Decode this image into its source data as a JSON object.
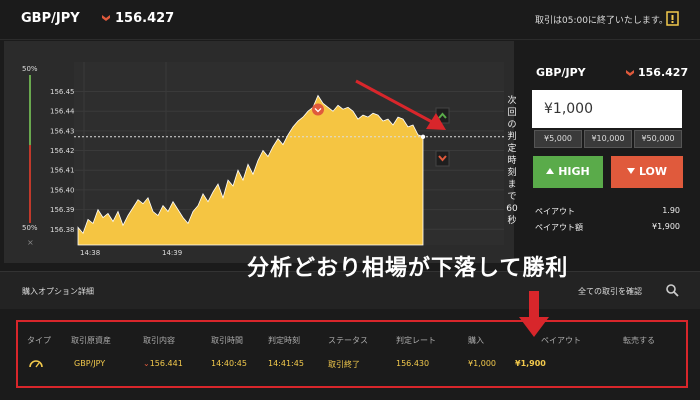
{
  "header": {
    "pair": "GBP/JPY",
    "price": "156.427",
    "notice": "取引は05:00に終了いたします。",
    "down_icon": "red-down-chevron",
    "notice_icon": "notice-icon"
  },
  "chart": {
    "vol_top": "50%",
    "vol_bottom": "50%",
    "vol_close": "×",
    "countdown": "次回の判定時刻まで60秒",
    "up_marker": "green-up-chevron",
    "down_marker": "red-down-chevron",
    "colors": {
      "area": "#f5c542",
      "high": "#5aab4a",
      "low": "#e05a3c",
      "annotation_red": "#d8262b"
    }
  },
  "chart_data": {
    "type": "area",
    "x": [
      0,
      5,
      10,
      15,
      20,
      25,
      30,
      35,
      40,
      45,
      50,
      55,
      60,
      65,
      70,
      75,
      80,
      85,
      90,
      95,
      100,
      105,
      110,
      115,
      120,
      125,
      130,
      135,
      140,
      145,
      150,
      155,
      160,
      165,
      170,
      175,
      180,
      185,
      190,
      195,
      200,
      205,
      210,
      215,
      220,
      225,
      230,
      235,
      240,
      245,
      250,
      255,
      260,
      265,
      270,
      275,
      280,
      285,
      290,
      295,
      300,
      305,
      310,
      315,
      320,
      325,
      330,
      335,
      340,
      345
    ],
    "values": [
      156.381,
      156.378,
      156.385,
      156.383,
      156.39,
      156.386,
      156.388,
      156.384,
      156.389,
      156.382,
      156.387,
      156.391,
      156.395,
      156.393,
      156.396,
      156.389,
      156.387,
      156.392,
      156.389,
      156.394,
      156.39,
      156.386,
      156.383,
      156.389,
      156.392,
      156.398,
      156.394,
      156.399,
      156.403,
      156.396,
      156.405,
      156.402,
      156.41,
      156.405,
      156.413,
      156.408,
      156.415,
      156.42,
      156.417,
      156.422,
      156.426,
      156.423,
      156.428,
      156.432,
      156.435,
      156.437,
      156.44,
      156.442,
      156.448,
      156.444,
      156.442,
      156.44,
      156.443,
      156.441,
      156.442,
      156.44,
      156.436,
      156.438,
      156.437,
      156.439,
      156.438,
      156.435,
      156.436,
      156.433,
      156.437,
      156.436,
      156.432,
      156.433,
      156.428,
      156.427
    ],
    "ylim": [
      156.372,
      156.465
    ],
    "y_ticks": [
      "156.45",
      "156.44",
      "156.43",
      "156.42",
      "156.41",
      "156.40",
      "156.39",
      "156.38"
    ],
    "x_ticks": [
      "14:38",
      "14:39"
    ],
    "reference_line": 156.427
  },
  "order": {
    "pair": "GBP/JPY",
    "price": "156.427",
    "amount": "¥1,000",
    "presets": [
      "¥5,000",
      "¥10,000",
      "¥50,000"
    ],
    "high_label": "HIGH",
    "low_label": "LOW",
    "payout_label": "ペイアウト",
    "payout_value": "1.90",
    "payout_amount_label": "ペイアウト額",
    "payout_amount_value": "¥1,900"
  },
  "section": {
    "title": "購入オプション詳細",
    "all_trades": "全ての取引を確認"
  },
  "annotation": {
    "text": "分析どおり相場が下落して勝利"
  },
  "table": {
    "headers": [
      "タイプ",
      "取引原資産",
      "取引内容",
      "取引時間",
      "判定時刻",
      "ステータス",
      "判定レート",
      "購入",
      "ペイアウト",
      "転売する"
    ],
    "row": {
      "type_icon": "gauge-icon",
      "asset": "GBP/JPY",
      "content": "156.441",
      "trade_time": "14:40:45",
      "judge_time": "14:41:45",
      "status": "取引終了",
      "judge_rate": "156.430",
      "purchase": "¥1,000",
      "payout": "¥1,900"
    }
  }
}
